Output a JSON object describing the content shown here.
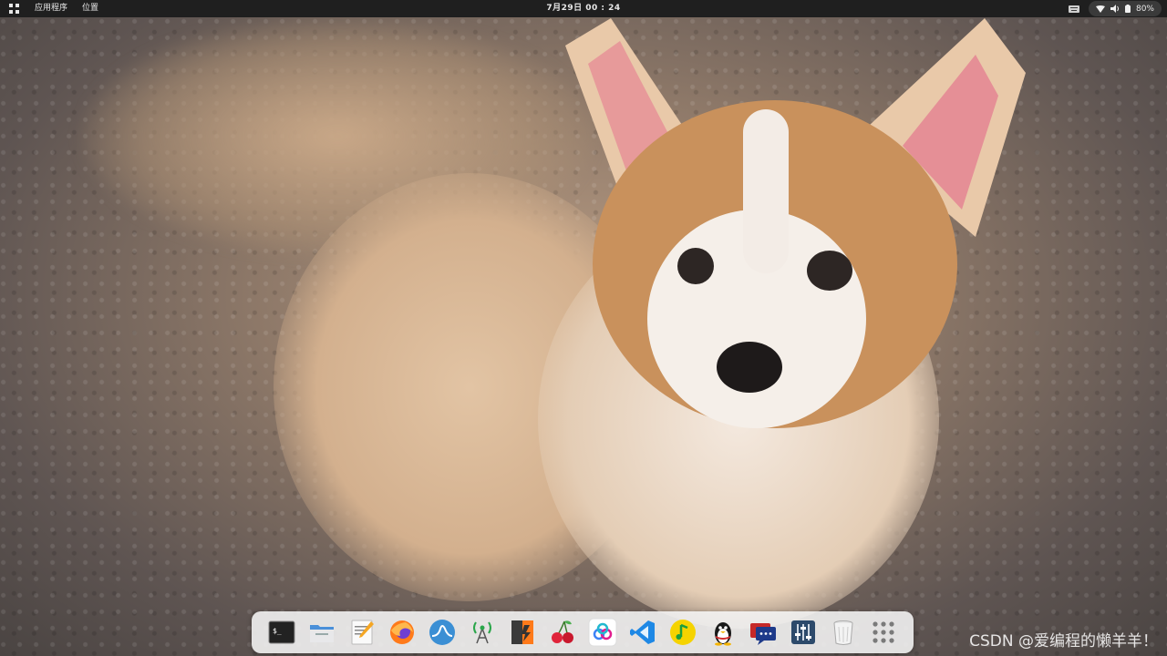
{
  "topbar": {
    "menus": [
      "应用程序",
      "位置"
    ],
    "clock": "7月29日  00 : 24",
    "battery_percent": "80%"
  },
  "dock": {
    "items": [
      {
        "name": "terminal",
        "icon": "terminal-icon"
      },
      {
        "name": "files",
        "icon": "folder-icon"
      },
      {
        "name": "text-editor",
        "icon": "text-editor-icon"
      },
      {
        "name": "firefox",
        "icon": "firefox-icon"
      },
      {
        "name": "system-monitor",
        "icon": "system-monitor-icon"
      },
      {
        "name": "network-tool",
        "icon": "antenna-icon"
      },
      {
        "name": "sublime-text",
        "icon": "sublime-icon"
      },
      {
        "name": "cherry",
        "icon": "cherry-icon"
      },
      {
        "name": "cloud-app",
        "icon": "cloud-app-icon"
      },
      {
        "name": "vscode",
        "icon": "vscode-icon"
      },
      {
        "name": "music",
        "icon": "music-icon"
      },
      {
        "name": "qq",
        "icon": "qq-penguin-icon"
      },
      {
        "name": "chat",
        "icon": "chat-icon"
      },
      {
        "name": "mixer",
        "icon": "mixer-icon"
      },
      {
        "name": "trash",
        "icon": "trash-icon"
      },
      {
        "name": "show-applications",
        "icon": "app-grid-icon"
      }
    ]
  },
  "wallpaper": {
    "subject": "corgi puppy"
  },
  "watermark": "CSDN @爱编程的懒羊羊！"
}
